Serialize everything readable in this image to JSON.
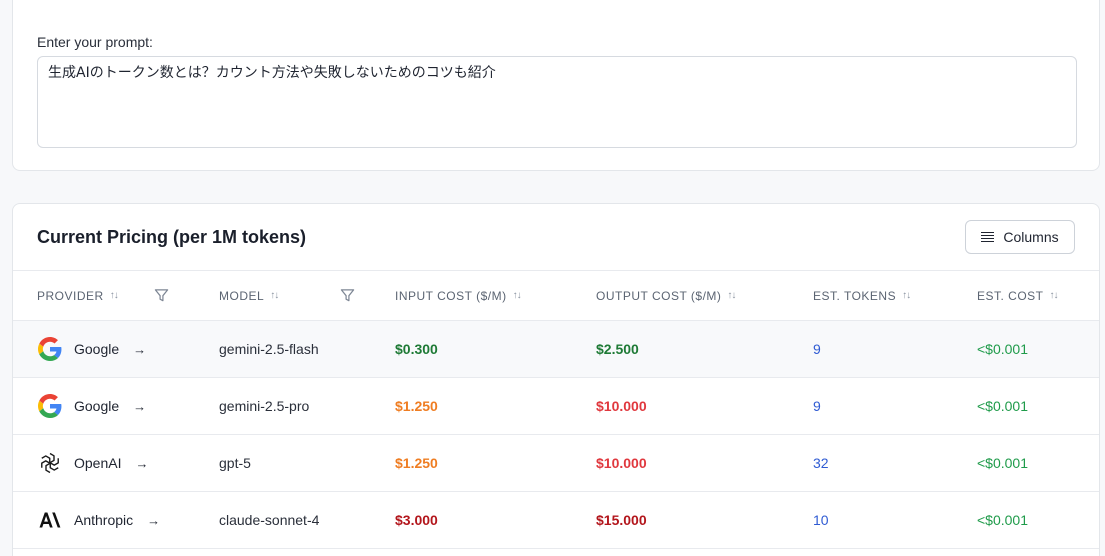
{
  "prompt": {
    "label": "Enter your prompt:",
    "value": "生成AIのトークン数とは？カウント方法や失敗しないためのコツも紹介"
  },
  "pricing": {
    "title": "Current Pricing (per 1M tokens)",
    "columns_button": "Columns",
    "headers": {
      "provider": "PROVIDER",
      "model": "MODEL",
      "input_cost": "INPUT COST ($/M)",
      "output_cost": "OUTPUT COST ($/M)",
      "est_tokens": "EST. TOKENS",
      "est_cost": "EST. COST"
    },
    "rows": [
      {
        "provider": "Google",
        "logo": "google-icon",
        "model": "gemini-2.5-flash",
        "input_cost": "$0.300",
        "input_color": "#1e7a35",
        "output_cost": "$2.500",
        "output_color": "#1e7a35",
        "est_tokens": "9",
        "est_cost": "<$0.001"
      },
      {
        "provider": "Google",
        "logo": "google-icon",
        "model": "gemini-2.5-pro",
        "input_cost": "$1.250",
        "input_color": "#ef7d22",
        "output_cost": "$10.000",
        "output_color": "#e0383e",
        "est_tokens": "9",
        "est_cost": "<$0.001"
      },
      {
        "provider": "OpenAI",
        "logo": "openai-icon",
        "model": "gpt-5",
        "input_cost": "$1.250",
        "input_color": "#ef7d22",
        "output_cost": "$10.000",
        "output_color": "#e0383e",
        "est_tokens": "32",
        "est_cost": "<$0.001"
      },
      {
        "provider": "Anthropic",
        "logo": "anthropic-icon",
        "model": "claude-sonnet-4",
        "input_cost": "$3.000",
        "input_color": "#b3161c",
        "output_cost": "$15.000",
        "output_color": "#b3161c",
        "est_tokens": "10",
        "est_cost": "<$0.001"
      }
    ]
  }
}
